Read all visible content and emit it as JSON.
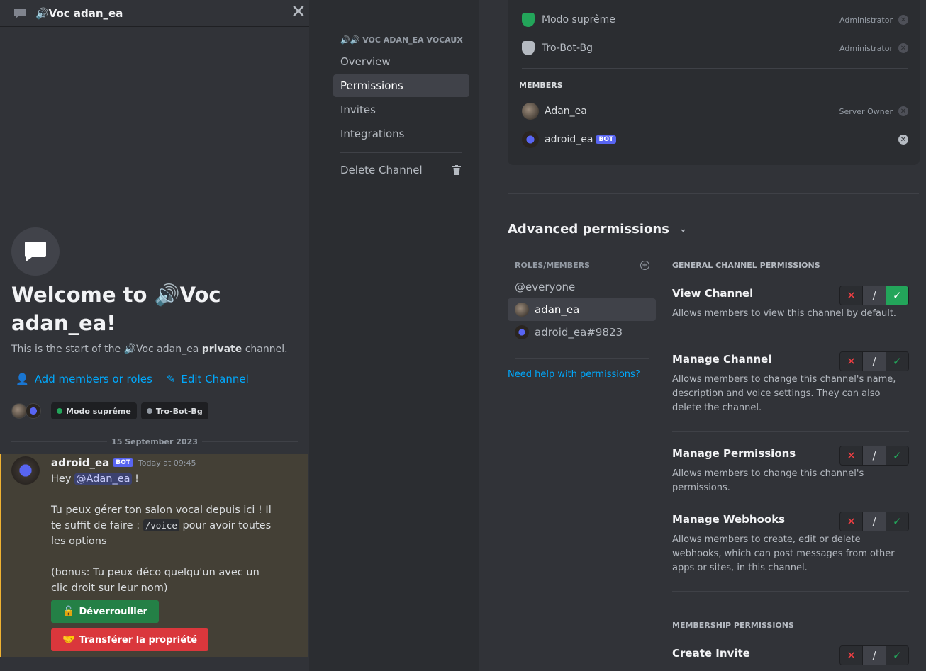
{
  "left": {
    "header_title": "🔊Voc adan_ea",
    "welcome_title": "Welcome to 🔊Voc adan_ea!",
    "welcome_prefix": "This is the start of the ",
    "welcome_channel": "🔊Voc adan_ea ",
    "welcome_private": "private",
    "welcome_suffix": " channel.",
    "add_members_label": "Add members or roles",
    "edit_channel_label": "Edit Channel",
    "chips": [
      {
        "label": "Modo suprême",
        "color": "#23a55a"
      },
      {
        "label": "Tro-Bot-Bg",
        "color": "#949ba4"
      }
    ],
    "date_divider": "15 September 2023",
    "message": {
      "author": "adroid_ea",
      "badge": "BOT",
      "time": "Today at 09:45",
      "line1_prefix": "Hey ",
      "mention": "@Adan_ea",
      "line1_suffix": " !",
      "para2_a": "Tu peux gérer ton salon vocal depuis ici ! Il te suffit de faire : ",
      "code": "/voice",
      "para2_b": " pour avoir toutes les options",
      "para3": "(bonus: Tu peux déco quelqu'un avec un clic droit sur leur nom)",
      "btn_unlock_emoji": "🔓",
      "btn_unlock": "Déverrouiller",
      "btn_transfer_emoji": "🤝",
      "btn_transfer": "Transférer la propriété"
    }
  },
  "nav": {
    "heading": "🔊🔊 VOC ADAN_EA VOCAUX",
    "items": [
      "Overview",
      "Permissions",
      "Invites",
      "Integrations"
    ],
    "delete": "Delete Channel",
    "active": "Permissions"
  },
  "roles_card": {
    "roles": [
      {
        "name": "Modo suprême",
        "tag": "Administrator",
        "color": "#23a55a"
      },
      {
        "name": "Tro-Bot-Bg",
        "tag": "Administrator",
        "color": "#b5bac1"
      }
    ],
    "members_heading": "MEMBERS",
    "members": [
      {
        "name": "Adan_ea",
        "tag": "Server Owner"
      },
      {
        "name": "adroid_ea",
        "badge": "BOT"
      }
    ]
  },
  "advanced": {
    "title": "Advanced permissions",
    "roles_members_heading": "ROLES/MEMBERS",
    "entries": [
      "@everyone",
      "adan_ea",
      "adroid_ea#9823"
    ],
    "active_entry": "adan_ea",
    "help_link": "Need help with permissions?",
    "general_heading": "GENERAL CHANNEL PERMISSIONS",
    "membership_heading": "MEMBERSHIP PERMISSIONS",
    "permissions": [
      {
        "title": "View Channel",
        "desc": "Allows members to view this channel by default.",
        "state": "allow"
      },
      {
        "title": "Manage Channel",
        "desc": "Allows members to change this channel's name, description and voice settings. They can also delete the channel.",
        "state": "neutral"
      },
      {
        "title": "Manage Permissions",
        "desc": "Allows members to change this channel's permissions.",
        "state": "neutral"
      },
      {
        "title": "Manage Webhooks",
        "desc": "Allows members to create, edit or delete webhooks, which can post messages from other apps or sites, in this channel.",
        "state": "neutral"
      },
      {
        "title": "Create Invite",
        "state": "neutral"
      }
    ],
    "tri_labels": {
      "deny": "✕",
      "neutral": "/",
      "allow": "✓"
    }
  }
}
